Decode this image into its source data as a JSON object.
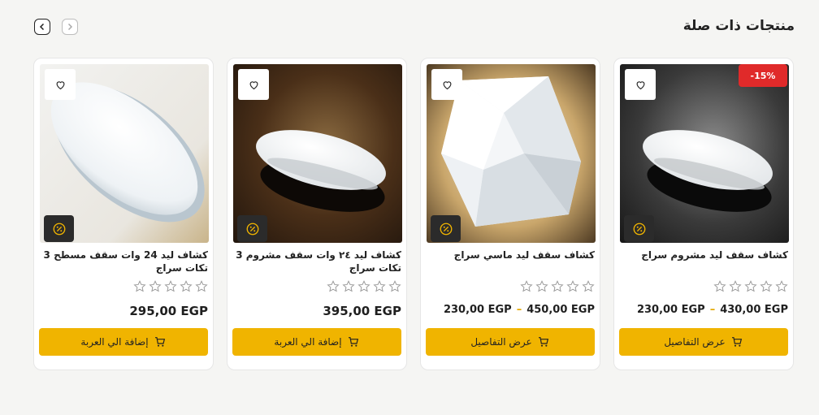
{
  "section": {
    "title": "منتجات ذات صلة"
  },
  "nav": {
    "prev_icon": "chevron-left-icon",
    "next_icon": "chevron-right-icon"
  },
  "colors": {
    "accent": "#f0b400",
    "sale": "#e02a2a",
    "text": "#1f1f1f"
  },
  "products": [
    {
      "name": "كشاف سقف ليد مشروم سراج",
      "badge": "-15%",
      "rating": 0,
      "price_low": "230,00 EGP",
      "price_high": "430,00 EGP",
      "price_separator": "–",
      "button": "عرض التفاصيل"
    },
    {
      "name": "كشاف سقف ليد ماسي سراج",
      "badge": "",
      "rating": 0,
      "price_low": "230,00 EGP",
      "price_high": "450,00 EGP",
      "price_separator": "–",
      "button": "عرض التفاصيل"
    },
    {
      "name": "كشاف ليد ٢٤ وات سقف مشروم 3 تكات سراج",
      "badge": "",
      "rating": 0,
      "price": "395,00 EGP",
      "button": "إضافة الي العربة"
    },
    {
      "name": "كشاف ليد 24 وات سقف مسطح 3 تكات سراج",
      "badge": "",
      "rating": 0,
      "price": "295,00 EGP",
      "button": "إضافة الي العربة"
    }
  ]
}
